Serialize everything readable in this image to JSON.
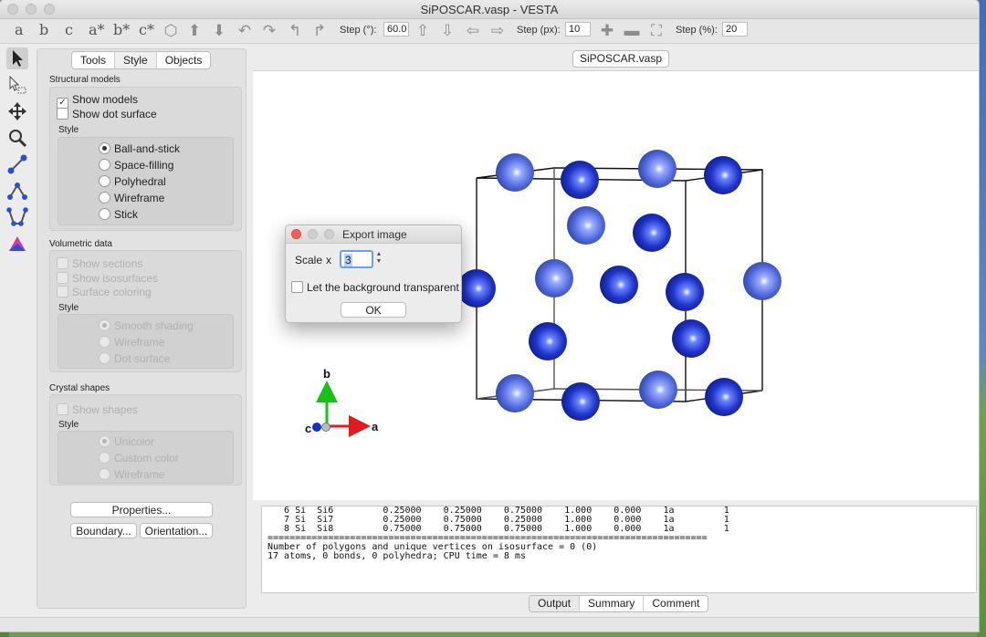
{
  "window": {
    "title": "SiPOSCAR.vasp - VESTA"
  },
  "toolbar": {
    "letters": [
      "a",
      "b",
      "c",
      "a*",
      "b*",
      "c*"
    ],
    "step_deg_label": "Step (°):",
    "step_deg_value": "60.0",
    "step_px_label": "Step (px):",
    "step_px_value": "10",
    "step_pct_label": "Step (%):",
    "step_pct_value": "20"
  },
  "panel": {
    "tabs": [
      "Tools",
      "Style",
      "Objects"
    ],
    "selected_tab": "Style",
    "structural": {
      "title": "Structural models",
      "show_models": "Show models",
      "show_dot_surface": "Show dot surface",
      "style_label": "Style",
      "styles": [
        "Ball-and-stick",
        "Space-filling",
        "Polyhedral",
        "Wireframe",
        "Stick"
      ],
      "selected": "Ball-and-stick"
    },
    "volumetric": {
      "title": "Volumetric data",
      "show_sections": "Show sections",
      "show_isosurfaces": "Show isosurfaces",
      "surface_coloring": "Surface coloring",
      "style_label": "Style",
      "styles": [
        "Smooth shading",
        "Wireframe",
        "Dot surface"
      ],
      "selected": "Smooth shading"
    },
    "crystal": {
      "title": "Crystal shapes",
      "show_shapes": "Show shapes",
      "style_label": "Style",
      "styles": [
        "Unicolor",
        "Custom color",
        "Wireframe"
      ],
      "selected": "Unicolor"
    },
    "buttons": {
      "properties": "Properties...",
      "boundary": "Boundary...",
      "orientation": "Orientation..."
    }
  },
  "view": {
    "tab": "SiPOSCAR.vasp",
    "axes": {
      "a": "a",
      "b": "b",
      "c": "c"
    },
    "atom_color": "#2438c8",
    "atom_color_light": "#5a72d8"
  },
  "dialog": {
    "title": "Export image",
    "scale_label": "Scale",
    "scale_x": "x",
    "scale_value": "3",
    "transparent_label": "Let the background transparent",
    "ok": "OK"
  },
  "output": {
    "lines": [
      "   6 Si  Si6         0.25000    0.25000    0.75000    1.000    0.000    1a         1",
      "   7 Si  Si7         0.25000    0.75000    0.25000    1.000    0.000    1a         1",
      "   8 Si  Si8         0.75000    0.75000    0.75000    1.000    0.000    1a         1",
      "================================================================================",
      "",
      "Number of polygons and unique vertices on isosurface = 0 (0)",
      "17 atoms, 0 bonds, 0 polyhedra; CPU time = 8 ms"
    ],
    "tabs": [
      "Output",
      "Summary",
      "Comment"
    ],
    "selected_tab": "Output"
  }
}
